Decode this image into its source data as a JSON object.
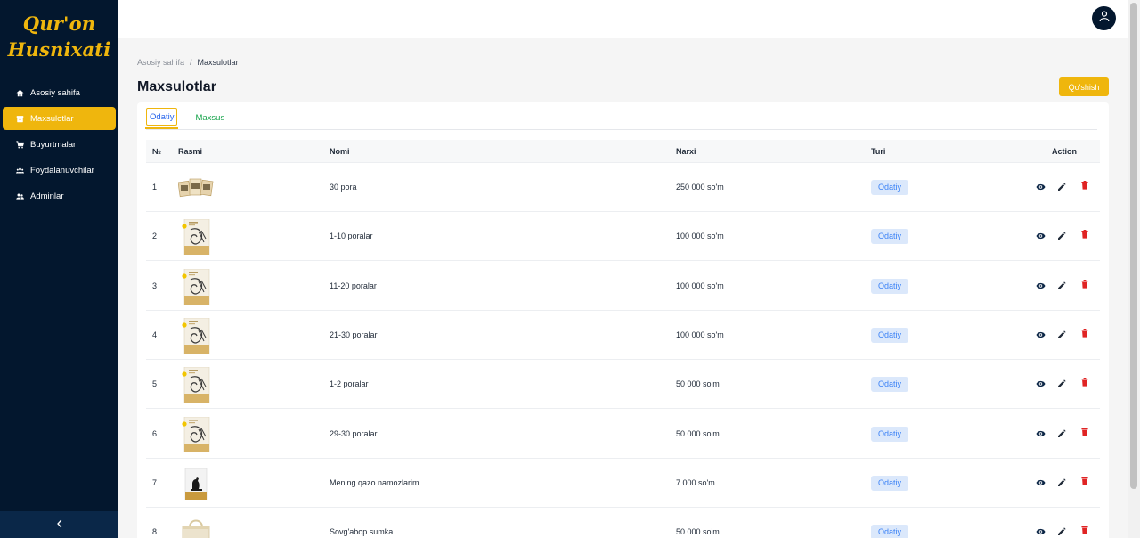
{
  "logo": {
    "line1": "Qur'on",
    "line2": "Husnixati"
  },
  "sidebar": {
    "items": [
      {
        "label": "Asosiy sahifa",
        "icon": "home-icon",
        "active": false
      },
      {
        "label": "Maxsulotlar",
        "icon": "box-icon",
        "active": true
      },
      {
        "label": "Buyurtmalar",
        "icon": "cart-icon",
        "active": false
      },
      {
        "label": "Foydalanuvchilar",
        "icon": "users-icon",
        "active": false
      },
      {
        "label": "Adminlar",
        "icon": "admins-icon",
        "active": false
      }
    ],
    "collapse_icon": "chevron-left-icon"
  },
  "header": {
    "avatar_icon": "user-icon"
  },
  "breadcrumb": {
    "home": "Asosiy sahifa",
    "separator": "/",
    "current": "Maxsulotlar"
  },
  "page": {
    "title": "Maxsulotlar",
    "add_button": "Qo'shish"
  },
  "tabs": [
    {
      "label": "Odatiy",
      "active": true
    },
    {
      "label": "Maxsus",
      "active": false
    }
  ],
  "table": {
    "headers": {
      "num": "№",
      "image": "Rasmi",
      "name": "Nomi",
      "price": "Narxi",
      "type": "Turi",
      "action": "Action"
    },
    "rows": [
      {
        "num": "1",
        "name": "30 pora",
        "price": "250 000 so'm",
        "type": "Odatiy",
        "image": "books-bundle-thumbnail"
      },
      {
        "num": "2",
        "name": "1-10 poralar",
        "price": "100 000 so'm",
        "type": "Odatiy",
        "image": "quran-book-thumbnail"
      },
      {
        "num": "3",
        "name": "11-20 poralar",
        "price": "100 000 so'm",
        "type": "Odatiy",
        "image": "quran-book-thumbnail"
      },
      {
        "num": "4",
        "name": "21-30 poralar",
        "price": "100 000 so'm",
        "type": "Odatiy",
        "image": "quran-book-thumbnail"
      },
      {
        "num": "5",
        "name": "1-2 poralar",
        "price": "50 000 so'm",
        "type": "Odatiy",
        "image": "quran-book-thumbnail"
      },
      {
        "num": "6",
        "name": "29-30 poralar",
        "price": "50 000 so'm",
        "type": "Odatiy",
        "image": "quran-book-thumbnail"
      },
      {
        "num": "7",
        "name": "Mening qazo namozlarim",
        "price": "7 000 so'm",
        "type": "Odatiy",
        "image": "prayer-book-thumbnail"
      },
      {
        "num": "8",
        "name": "Sovg'abop sumka",
        "price": "50 000 so'm",
        "type": "Odatiy",
        "image": "gift-bag-thumbnail"
      }
    ],
    "action_icons": [
      "view-icon",
      "edit-icon",
      "delete-icon"
    ]
  },
  "colors": {
    "sidebar_bg": "#03172e",
    "accent": "#efb60d",
    "badge_bg": "#dbe8fb",
    "badge_text": "#3b82f6",
    "delete": "#e02424"
  }
}
